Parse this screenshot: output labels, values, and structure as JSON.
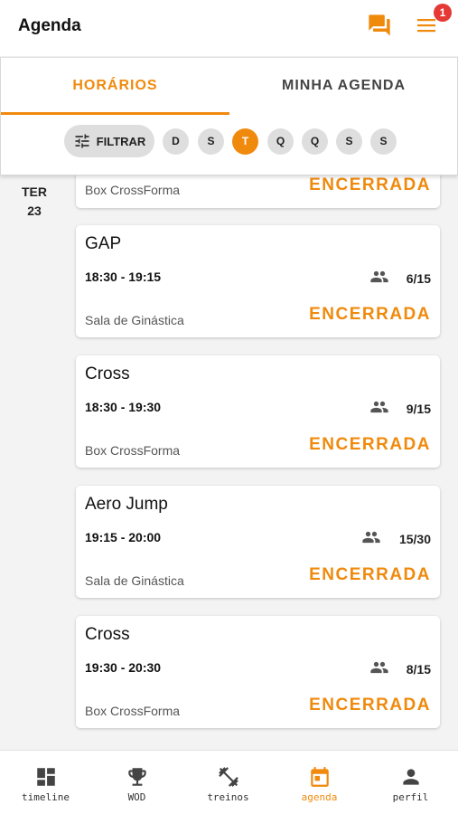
{
  "app": {
    "title": "Agenda",
    "notification_count": "1"
  },
  "icons": {
    "chat": "chat-icon",
    "menu": "menu-icon",
    "filter": "tune-icon",
    "people": "people-icon"
  },
  "colors": {
    "accent": "#f08a0d",
    "badge": "#e53935"
  },
  "tabs": [
    {
      "label": "HORÁRIOS",
      "active": true
    },
    {
      "label": "MINHA AGENDA",
      "active": false
    }
  ],
  "filter": {
    "label": "FILTRAR"
  },
  "days": [
    "D",
    "S",
    "T",
    "Q",
    "Q",
    "S",
    "S"
  ],
  "selected_day_index": 2,
  "date": {
    "weekday": "TER",
    "day": "23"
  },
  "classes": [
    {
      "name": "",
      "time": "",
      "count": "",
      "place": "Box CrossForma",
      "status": "ENCERRADA"
    },
    {
      "name": "GAP",
      "time": "18:30 - 19:15",
      "count": "6/15",
      "place": "Sala de Ginástica",
      "status": "ENCERRADA"
    },
    {
      "name": "Cross",
      "time": "18:30 - 19:30",
      "count": "9/15",
      "place": "Box CrossForma",
      "status": "ENCERRADA"
    },
    {
      "name": "Aero Jump",
      "time": "19:15 - 20:00",
      "count": "15/30",
      "place": "Sala de Ginástica",
      "status": "ENCERRADA"
    },
    {
      "name": "Cross",
      "time": "19:30 - 20:30",
      "count": "8/15",
      "place": "Box CrossForma",
      "status": "ENCERRADA"
    }
  ],
  "bottom_nav": [
    {
      "label": "timeline",
      "icon": "dashboard-icon",
      "active": false
    },
    {
      "label": "WOD",
      "icon": "trophy-icon",
      "active": false
    },
    {
      "label": "treinos",
      "icon": "dumbbell-icon",
      "active": false
    },
    {
      "label": "agenda",
      "icon": "calendar-icon",
      "active": true
    },
    {
      "label": "perfil",
      "icon": "person-icon",
      "active": false
    }
  ]
}
